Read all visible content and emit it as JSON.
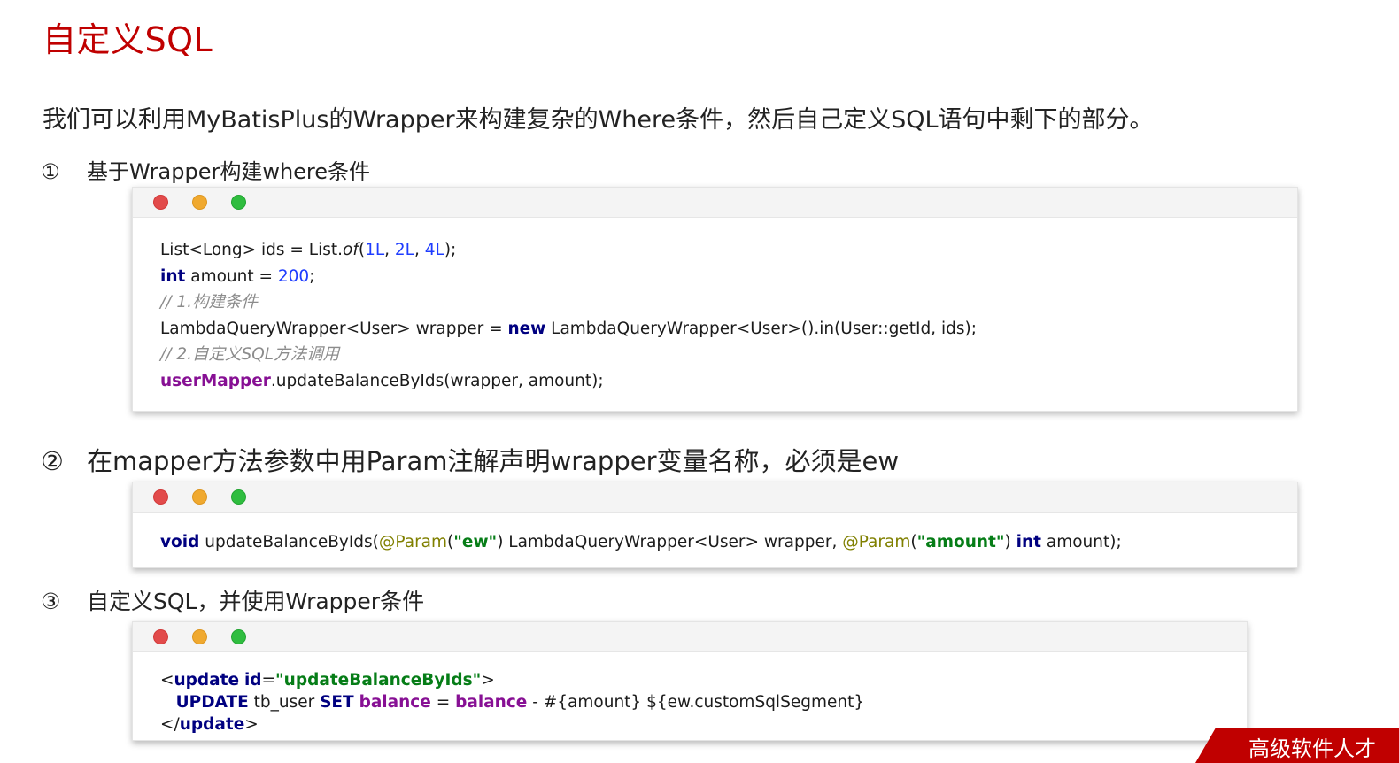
{
  "title": "自定义SQL",
  "intro": "我们可以利用MyBatisPlus的Wrapper来构建复杂的Where条件，然后自己定义SQL语句中剩下的部分。",
  "steps": [
    {
      "num": "①",
      "text": "基于Wrapper构建where条件"
    },
    {
      "num": "②",
      "text": "在mapper方法参数中用Param注解声明wrapper变量名称，必须是ew"
    },
    {
      "num": "③",
      "text": "自定义SQL，并使用Wrapper条件"
    }
  ],
  "code1": {
    "l1": {
      "a": "List<Long> ids = List.",
      "of": "of",
      "b": "(",
      "n1": "1L",
      "c1": ", ",
      "n2": "2L",
      "c2": ", ",
      "n3": "4L",
      "end": ");"
    },
    "l2": {
      "kw": "int",
      "a": " amount = ",
      "n": "200",
      "end": ";"
    },
    "l3": "// 1.构建条件",
    "l4": {
      "a": "LambdaQueryWrapper<User> wrapper = ",
      "kw": "new",
      "b": " LambdaQueryWrapper<User>().in(User::getId, ids);"
    },
    "l5": "// 2.自定义SQL方法调用",
    "l6": {
      "fld": "userMapper",
      "a": ".updateBalanceByIds(wrapper, amount);"
    }
  },
  "code2": {
    "kw1": "void",
    "a": " updateBalanceByIds(",
    "ann1": "@Param",
    "p1": "(",
    "s1": "\"ew\"",
    "b": ") LambdaQueryWrapper<User> wrapper, ",
    "ann2": "@Param",
    "p2": "(",
    "s2": "\"amount\"",
    "c": ") ",
    "kw2": "int",
    "d": " amount);"
  },
  "code3": {
    "l1": {
      "lt": "<",
      "tag": "update",
      "sp": " ",
      "attr": "id",
      "eq": "=",
      "val": "\"updateBalanceByIds\"",
      "gt": ">"
    },
    "l2": {
      "indent": "   ",
      "kw1": "UPDATE",
      "a": " tb_user ",
      "kw2": "SET",
      "sp": " ",
      "f1": "balance",
      "b": " = ",
      "f2": "balance",
      "c": " - #{amount} ${ew.customSqlSegment}"
    },
    "l3": {
      "lt": "</",
      "tag": "update",
      "gt": ">"
    }
  },
  "watermark": "高级软件人才"
}
